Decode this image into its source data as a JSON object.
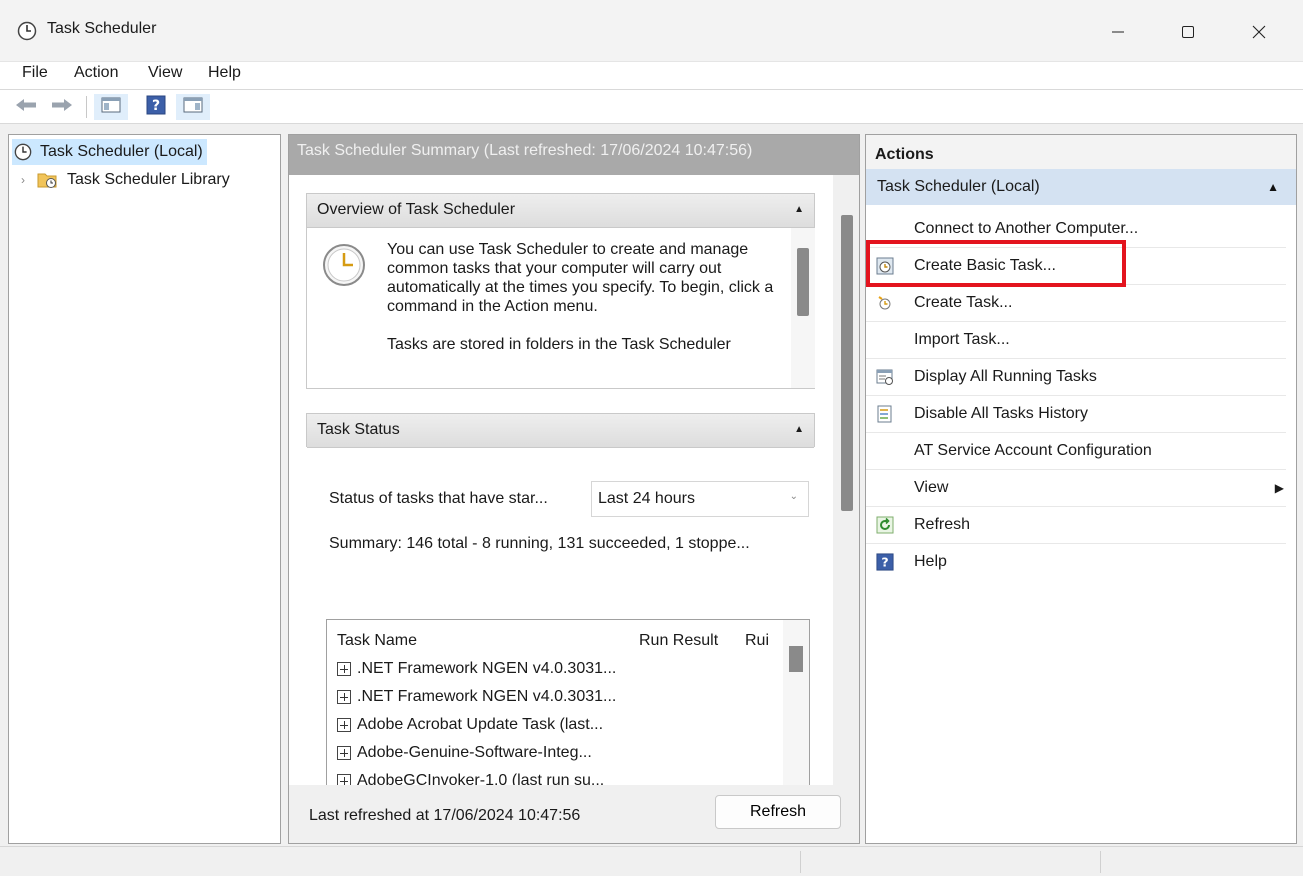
{
  "window": {
    "title": "Task Scheduler",
    "controls": [
      "minimize",
      "maximize",
      "close"
    ]
  },
  "menu": {
    "items": [
      "File",
      "Action",
      "View",
      "Help"
    ]
  },
  "toolbar": {
    "icons": [
      "back-arrow-icon",
      "forward-arrow-icon",
      "show-hide-console-tree-icon",
      "help-icon",
      "show-hide-action-pane-icon"
    ]
  },
  "tree": {
    "root_label": "Task Scheduler (Local)",
    "library_label": "Task Scheduler Library"
  },
  "center": {
    "header": "Task Scheduler Summary (Last refreshed: 17/06/2024 10:47:56)",
    "overview": {
      "title": "Overview of Task Scheduler",
      "para1": "You can use Task Scheduler to create and manage common tasks that your computer will carry out automatically at the times you specify. To begin, click a command in the Action menu.",
      "para2": "Tasks are stored in folders in the Task Scheduler"
    },
    "task_status": {
      "title": "Task Status",
      "status_label": "Status of tasks that have star...",
      "period_selected": "Last 24 hours",
      "summary": "Summary: 146 total - 8 running, 131 succeeded, 1 stoppe...",
      "columns": [
        "Task Name",
        "Run Result",
        "Rui"
      ],
      "rows": [
        ".NET Framework NGEN v4.0.3031...",
        ".NET Framework NGEN v4.0.3031...",
        "Adobe Acrobat Update Task (last...",
        "Adobe-Genuine-Software-Integ...",
        "AdobeGCInvoker-1.0 (last run su..."
      ]
    },
    "footer": {
      "last_refreshed": "Last refreshed at 17/06/2024 10:47:56",
      "refresh_label": "Refresh"
    }
  },
  "actions": {
    "title": "Actions",
    "group": "Task Scheduler (Local)",
    "items": [
      {
        "label": "Connect to Another Computer...",
        "icon": ""
      },
      {
        "label": "Create Basic Task...",
        "icon": "create-basic-task-icon"
      },
      {
        "label": "Create Task...",
        "icon": "create-task-icon"
      },
      {
        "label": "Import Task...",
        "icon": ""
      },
      {
        "label": "Display All Running Tasks",
        "icon": "running-tasks-icon"
      },
      {
        "label": "Disable All Tasks History",
        "icon": "tasks-history-icon"
      },
      {
        "label": "AT Service Account Configuration",
        "icon": ""
      },
      {
        "label": "View",
        "icon": ""
      },
      {
        "label": "Refresh",
        "icon": "refresh-icon"
      },
      {
        "label": "Help",
        "icon": "help-icon"
      }
    ],
    "highlighted": "Create Basic Task..."
  },
  "colors": {
    "highlight": "#e3141e",
    "selection": "#cce8ff",
    "group_header": "#d4e2f2",
    "center_header": "#a9a9a9"
  }
}
